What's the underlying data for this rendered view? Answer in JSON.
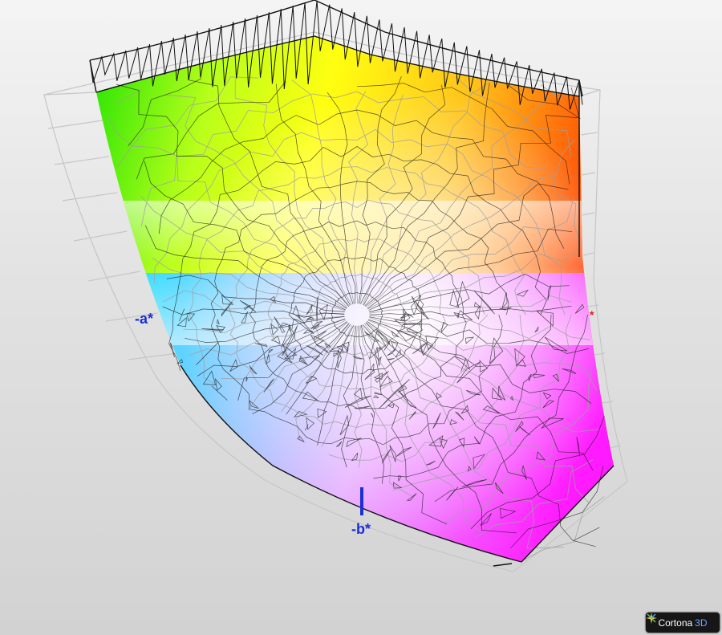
{
  "axes": {
    "neg_a": "-a*",
    "pos_a": "*",
    "neg_b": "-b*"
  },
  "branding": {
    "name": "Cortona",
    "suffix": "3D",
    "icon": "cortona-star-icon"
  },
  "colors": {
    "neg_a_label": "#1a2fd6",
    "pos_a_label": "#e21b1b",
    "neg_b_axis": "#1a2fd6",
    "wire_dark": "#1a1a1a",
    "wire_light": "#a8a8a8"
  }
}
